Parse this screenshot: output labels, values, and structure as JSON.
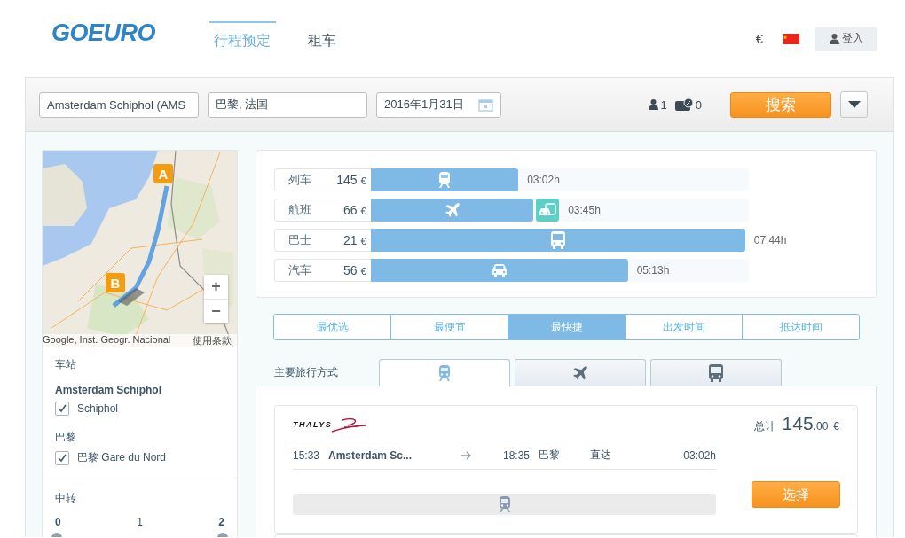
{
  "header": {
    "logo": "GOEURO",
    "nav": [
      {
        "label": "行程预定",
        "selected": true
      },
      {
        "label": "租车",
        "selected": false
      }
    ],
    "currency": "€",
    "login": "登入"
  },
  "search": {
    "from": "Amsterdam Schiphol (AMS",
    "to": "巴黎, 法国",
    "date": "2016年1月31日",
    "passengers": "1",
    "discount_cards": "0",
    "search_button": "搜索"
  },
  "sidebar": {
    "map": {
      "pins": [
        {
          "label": "A"
        },
        {
          "label": "B"
        }
      ],
      "zoom_in": "+",
      "zoom_out": "−",
      "attribution": "Google, Inst. Geogr. Nacional",
      "terms": "使用条款"
    },
    "stations_title": "车站",
    "station_groups": [
      {
        "title": "Amsterdam Schiphol",
        "options": [
          {
            "label": "Schiphol",
            "checked": true
          }
        ]
      },
      {
        "title": "巴黎",
        "options": [
          {
            "label": "巴黎 Gare du Nord",
            "checked": true
          }
        ]
      }
    ],
    "transfers_title": "中转",
    "transfer_stops": [
      {
        "label": "0",
        "selected": true
      },
      {
        "label": "1",
        "selected": false
      },
      {
        "label": "2",
        "selected": true
      }
    ]
  },
  "modes": [
    {
      "kind": "train",
      "label": "列车",
      "price": "145",
      "currency": "€",
      "level": 0.39,
      "duration": "03:02h",
      "transfer": false
    },
    {
      "kind": "flight",
      "label": "航班",
      "price": "66",
      "currency": "€",
      "level": 0.43,
      "duration": "03:45h",
      "transfer": true
    },
    {
      "kind": "bus",
      "label": "巴士",
      "price": "21",
      "currency": "€",
      "level": 0.99,
      "duration": "07:44h",
      "transfer": false
    },
    {
      "kind": "car",
      "label": "汽车",
      "price": "56",
      "currency": "€",
      "level": 0.68,
      "duration": "05:13h",
      "transfer": false
    }
  ],
  "sort_tabs": [
    {
      "label": "最优选",
      "selected": false
    },
    {
      "label": "最便宜",
      "selected": false
    },
    {
      "label": "最快捷",
      "selected": true
    },
    {
      "label": "出发时间",
      "selected": false
    },
    {
      "label": "抵达时间",
      "selected": false
    }
  ],
  "travel_mode_label": "主要旅行方式",
  "travel_mode_tabs": [
    {
      "kind": "train",
      "selected": true
    },
    {
      "kind": "flight",
      "selected": false
    },
    {
      "kind": "bus",
      "selected": false
    }
  ],
  "result": {
    "operator": "THALYS",
    "total_label": "总计",
    "price": "145",
    "price_cents": ".00",
    "currency": "€",
    "departure_time": "15:33",
    "from": "Amsterdam Sc...",
    "arrival_time": "18:35",
    "to": "巴黎",
    "stops": "直达",
    "duration": "03:02h",
    "kind": "train",
    "select_button": "选择"
  }
}
